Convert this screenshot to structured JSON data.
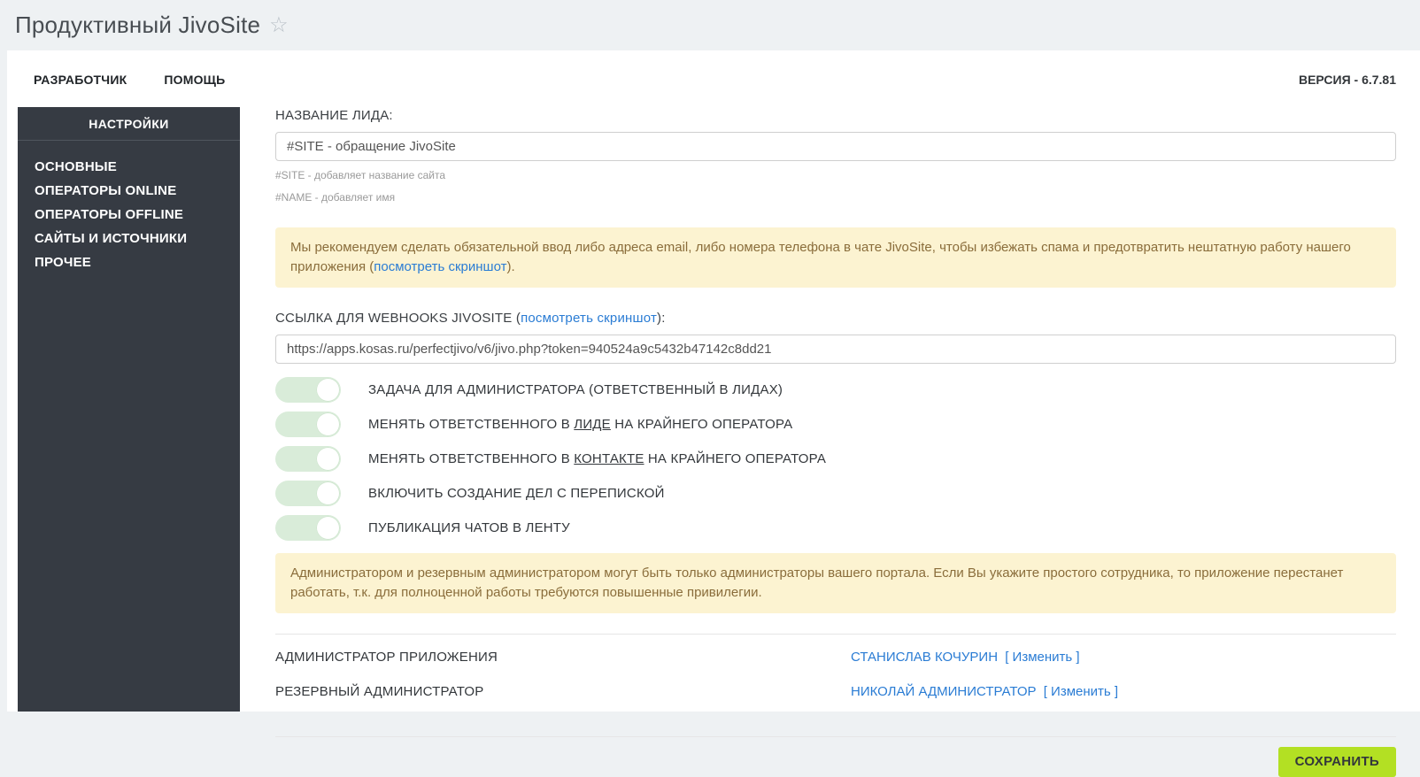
{
  "title_bar": {
    "title": "Продуктивный JivoSite",
    "star_icon": "☆"
  },
  "nav": {
    "items": [
      "РАЗРАБОТЧИК",
      "ПОМОЩЬ"
    ],
    "version": "ВЕРСИЯ - 6.7.81"
  },
  "sidebar": {
    "header": "НАСТРОЙКИ",
    "items": [
      "ОСНОВНЫЕ",
      "ОПЕРАТОРЫ ONLINE",
      "ОПЕРАТОРЫ OFFLINE",
      "САЙТЫ И ИСТОЧНИКИ",
      "ПРОЧЕЕ"
    ]
  },
  "form": {
    "lead_name": {
      "label": "НАЗВАНИЕ ЛИДА:",
      "value": "#SITE - обращение JivoSite",
      "hints": [
        "#SITE - добавляет название сайта",
        "#NAME - добавляет имя"
      ]
    },
    "warning_email": {
      "before": "Мы рекомендуем сделать обязательной ввод либо адреса email, либо номера телефона в чате JivoSite, чтобы избежать спама и предотвратить нештатную работу нашего приложения (",
      "link": "посмотреть скриншот",
      "after": ")."
    },
    "webhook": {
      "label_before": "ССЫЛКА ДЛЯ WEBHOOKS JIVOSITE (",
      "link": "посмотреть скриншот",
      "label_after": "):",
      "value": "https://apps.kosas.ru/perfectjivo/v6/jivo.php?token=940524a9c5432b47142c8dd21"
    },
    "toggles": [
      {
        "before": "ЗАДАЧА ДЛЯ АДМИНИСТРАТОРА (ОТВЕТСТВЕННЫЙ В ЛИДАХ)",
        "underline": "",
        "after": "",
        "state": "on"
      },
      {
        "before": "МЕНЯТЬ ОТВЕТСТВЕННОГО В ",
        "underline": "ЛИДЕ",
        "after": " НА КРАЙНЕГО ОПЕРАТОРА",
        "state": "on"
      },
      {
        "before": "МЕНЯТЬ ОТВЕТСТВЕННОГО В ",
        "underline": "КОНТАКТЕ",
        "after": " НА КРАЙНЕГО ОПЕРАТОРА",
        "state": "on"
      },
      {
        "before": "ВКЛЮЧИТЬ СОЗДАНИЕ ДЕЛ С ПЕРЕПИСКОЙ",
        "underline": "",
        "after": "",
        "state": "on"
      },
      {
        "before": "ПУБЛИКАЦИЯ ЧАТОВ В ЛЕНТУ",
        "underline": "",
        "after": "",
        "state": "on"
      }
    ],
    "warning_admin": {
      "text": "Администратором и резервным администратором могут быть только администраторы вашего портала. Если Вы укажите простого сотрудника, то приложение перестанет работать, т.к. для полноценной работы требуются повышенные привилегии."
    },
    "admins": [
      {
        "label": "АДМИНИСТРАТОР ПРИЛОЖЕНИЯ",
        "name": "СТАНИСЛАВ КОЧУРИН",
        "action": "[ Изменить ]"
      },
      {
        "label": "РЕЗЕРВНЫЙ АДМИНИСТРАТОР",
        "name": "НИКОЛАЙ АДМИНИСТРАТОР",
        "action": "[ Изменить ]"
      }
    ],
    "save_label": "СОХРАНИТЬ"
  },
  "colors": {
    "accent_save": "#b3e023",
    "warning_bg": "#fcf3d1",
    "warning_text": "#8a6d3b",
    "link_blue": "#2a7cd4",
    "sidebar_bg": "#363b43",
    "toggle_track_on": "#d9ecd9",
    "topbar_bg": "#eef1f3"
  }
}
